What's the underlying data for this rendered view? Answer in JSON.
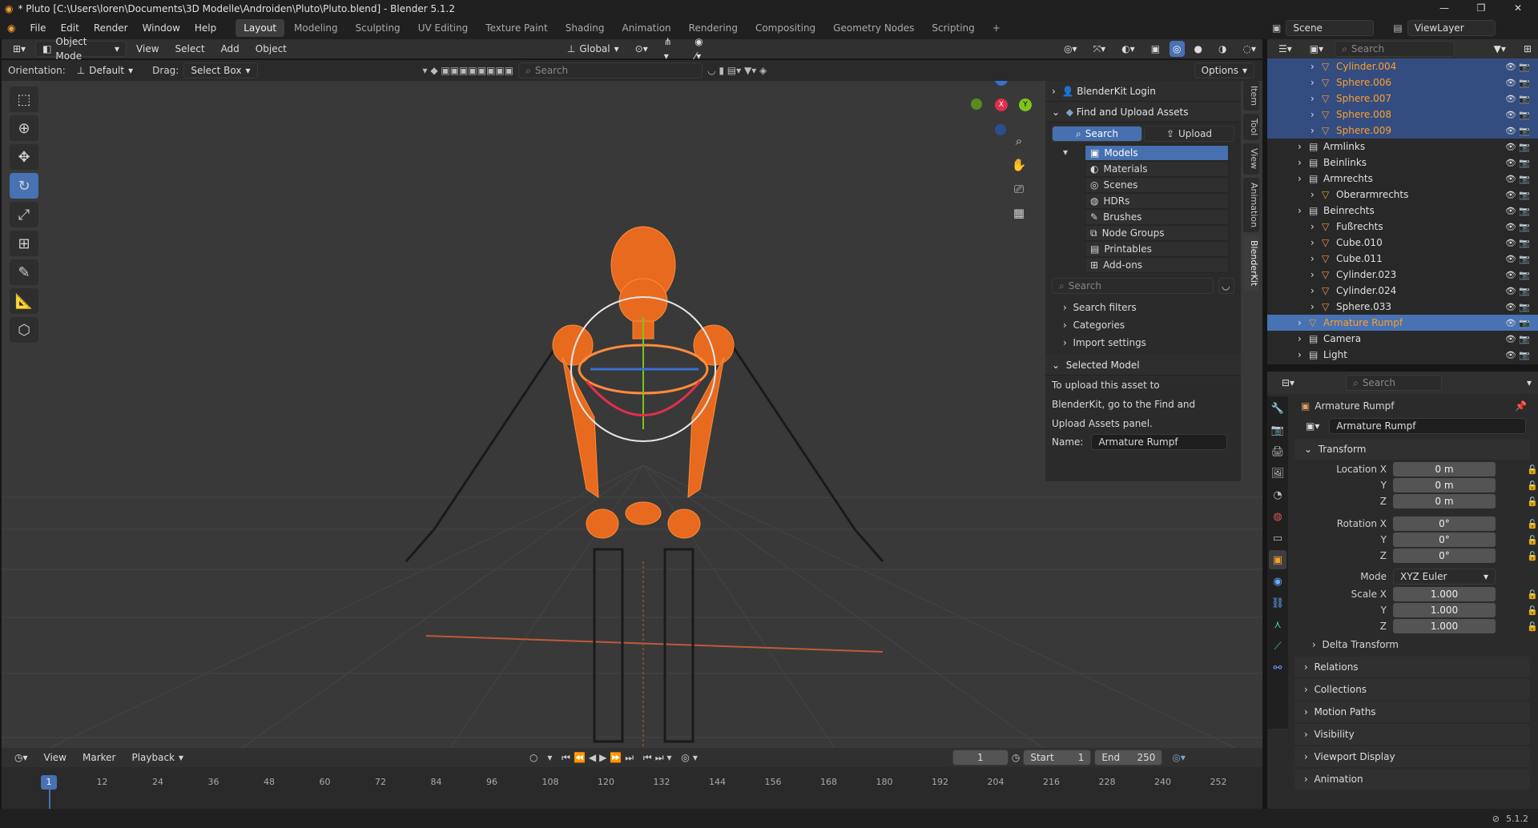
{
  "titlebar": {
    "title": "* Pluto [C:\\Users\\loren\\Documents\\3D Modelle\\Androiden\\Pluto\\Pluto.blend] - Blender 5.1.2"
  },
  "menubar": {
    "menus": [
      "File",
      "Edit",
      "Render",
      "Window",
      "Help"
    ],
    "workspaces": [
      "Layout",
      "Modeling",
      "Sculpting",
      "UV Editing",
      "Texture Paint",
      "Shading",
      "Animation",
      "Rendering",
      "Compositing",
      "Geometry Nodes",
      "Scripting"
    ],
    "active_workspace": "Layout",
    "scene": "Scene",
    "view_layer": "ViewLayer"
  },
  "viewport_header": {
    "mode": "Object Mode",
    "menus": [
      "View",
      "Select",
      "Add",
      "Object"
    ],
    "transform_orientation": "Global"
  },
  "tool_header": {
    "orientation_label": "Orientation:",
    "orientation_value": "Default",
    "drag_label": "Drag:",
    "drag_value": "Select Box",
    "search_placeholder": "Search",
    "options": "Options"
  },
  "npanel": {
    "login": "BlenderKit Login",
    "find_upload": "Find and Upload Assets",
    "search_tab": "Search",
    "upload_tab": "Upload",
    "categories": [
      "Models",
      "Materials",
      "Scenes",
      "HDRs",
      "Brushes",
      "Node Groups",
      "Printables",
      "Add-ons"
    ],
    "selected_category": "Models",
    "search_placeholder": "Search",
    "search_filters": "Search filters",
    "categories_label": "Categories",
    "import_settings": "Import settings",
    "selected_model": "Selected Model",
    "upload_hint_1": "To upload this asset to",
    "upload_hint_2": "BlenderKit, go to the Find and",
    "upload_hint_3": "Upload Assets panel.",
    "name_label": "Name:",
    "name_value": "Armature Rumpf",
    "side_tabs": [
      "Item",
      "Tool",
      "View",
      "Animation",
      "BlenderKit"
    ],
    "active_side_tab": "BlenderKit"
  },
  "outliner": {
    "search_placeholder": "Search",
    "rows": [
      {
        "name": "Cylinder.004",
        "indent": 3,
        "sel": true,
        "orange": true
      },
      {
        "name": "Sphere.006",
        "indent": 3,
        "sel": true,
        "orange": true
      },
      {
        "name": "Sphere.007",
        "indent": 3,
        "sel": true,
        "orange": true
      },
      {
        "name": "Sphere.008",
        "indent": 3,
        "sel": true,
        "orange": true
      },
      {
        "name": "Sphere.009",
        "indent": 3,
        "sel": true,
        "orange": true
      },
      {
        "name": "Armlinks",
        "indent": 2,
        "sel": false,
        "orange": false
      },
      {
        "name": "Beinlinks",
        "indent": 2,
        "sel": false,
        "orange": false
      },
      {
        "name": "Armrechts",
        "indent": 2,
        "sel": false,
        "orange": false
      },
      {
        "name": "Oberarmrechts",
        "indent": 3,
        "sel": false,
        "orange": false
      },
      {
        "name": "Beinrechts",
        "indent": 2,
        "sel": false,
        "orange": false
      },
      {
        "name": "Fußrechts",
        "indent": 3,
        "sel": false,
        "orange": false
      },
      {
        "name": "Cube.010",
        "indent": 3,
        "sel": false,
        "orange": false
      },
      {
        "name": "Cube.011",
        "indent": 3,
        "sel": false,
        "orange": false
      },
      {
        "name": "Cylinder.023",
        "indent": 3,
        "sel": false,
        "orange": false
      },
      {
        "name": "Cylinder.024",
        "indent": 3,
        "sel": false,
        "orange": false
      },
      {
        "name": "Sphere.033",
        "indent": 3,
        "sel": false,
        "orange": false
      },
      {
        "name": "Armature Rumpf",
        "indent": 2,
        "sel": true,
        "active": true,
        "orange": true
      },
      {
        "name": "Camera",
        "indent": 2,
        "sel": false,
        "orange": false
      },
      {
        "name": "Light",
        "indent": 2,
        "sel": false,
        "orange": false
      }
    ]
  },
  "properties": {
    "search_placeholder": "Search",
    "object_name": "Armature Rumpf",
    "transform": "Transform",
    "location_x_label": "Location X",
    "y_label": "Y",
    "z_label": "Z",
    "location_x": "0 m",
    "location_y": "0 m",
    "location_z": "0 m",
    "rotation_x_label": "Rotation X",
    "rotation_x": "0°",
    "rotation_y": "0°",
    "rotation_z": "0°",
    "mode_label": "Mode",
    "mode_value": "XYZ Euler",
    "scale_x_label": "Scale X",
    "scale_x": "1.000",
    "scale_y": "1.000",
    "scale_z": "1.000",
    "delta_transform": "Delta Transform",
    "sections": [
      "Relations",
      "Collections",
      "Motion Paths",
      "Visibility",
      "Viewport Display",
      "Animation"
    ]
  },
  "timeline": {
    "menus": [
      "View",
      "Marker",
      "Playback"
    ],
    "current_frame": "1",
    "start_label": "Start",
    "start": "1",
    "end_label": "End",
    "end": "250",
    "ticks": [
      "12",
      "24",
      "36",
      "48",
      "60",
      "72",
      "84",
      "96",
      "108",
      "120",
      "132",
      "144",
      "156",
      "168",
      "180",
      "192",
      "204",
      "216",
      "228",
      "240",
      "252"
    ],
    "playhead": "1"
  },
  "statusbar": {
    "version": "5.1.2"
  },
  "colors": {
    "accent": "#4772b3",
    "selected_orange": "#ff9e2c",
    "viewport_bg": "#393939"
  }
}
